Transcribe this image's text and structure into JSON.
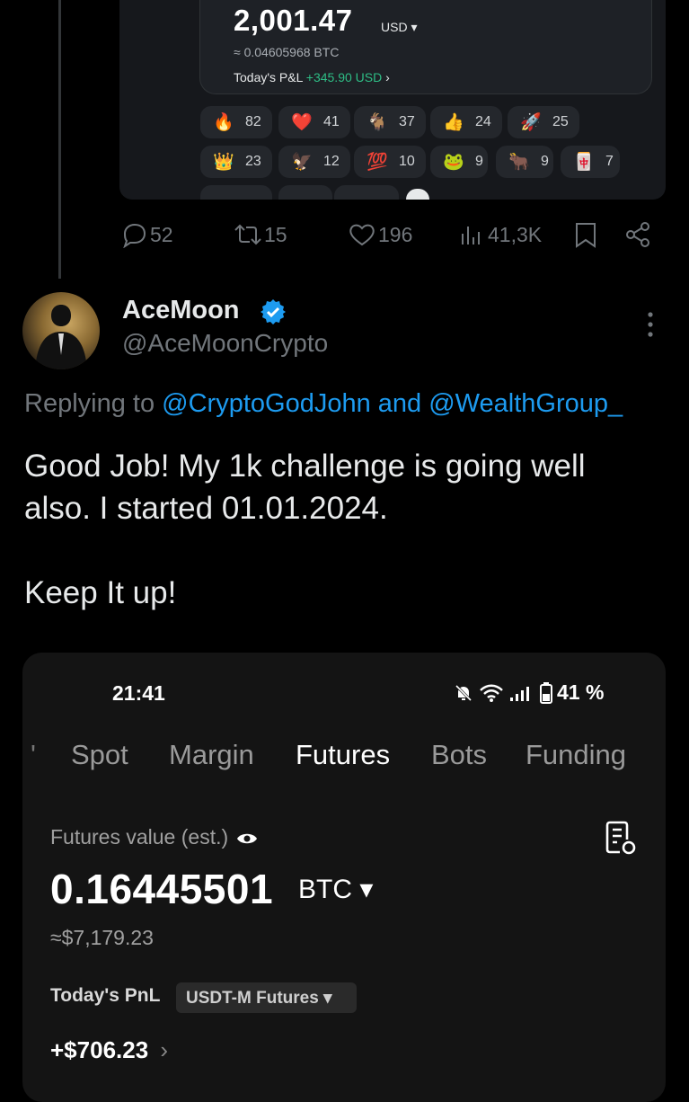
{
  "quoted_card": {
    "amount": "2,001.47",
    "unit": "USD ▾",
    "btc": "≈ 0.04605968 BTC",
    "pnl_label": "Today's P&L",
    "pnl_value": "+345.90 USD",
    "pnl_chevron": "›",
    "reactions": [
      {
        "emoji": "🔥",
        "count": "82"
      },
      {
        "emoji": "❤️",
        "count": "41"
      },
      {
        "emoji": "🐐",
        "count": "37"
      },
      {
        "emoji": "👍",
        "count": "24"
      },
      {
        "emoji": "🚀",
        "count": "25"
      },
      {
        "emoji": "👑",
        "count": "23"
      },
      {
        "emoji": "🦅",
        "count": "12"
      },
      {
        "emoji": "💯",
        "count": "10"
      },
      {
        "emoji": "🐸",
        "count": "9"
      },
      {
        "emoji": "🐂",
        "count": "9"
      },
      {
        "emoji": "🀄",
        "count": "7"
      }
    ]
  },
  "actions": {
    "replies": "52",
    "reposts": "15",
    "likes": "196",
    "views": "41,3K"
  },
  "tweet": {
    "display_name": "AceMoon",
    "handle": "@AceMoonCrypto",
    "replying_prefix": "Replying to ",
    "replying_user1": "@CryptoGodJohn",
    "replying_and": " and ",
    "replying_user2": "@WealthGroup_",
    "body_line1": "Good Job! My 1k challenge is going well",
    "body_line2": "also. I started 01.01.2024.",
    "body_line3": "Keep It up!"
  },
  "screenshot": {
    "time": "21:41",
    "battery": "41 %",
    "tab_partial": "'",
    "tabs": [
      "Spot",
      "Margin",
      "Futures",
      "Bots",
      "Funding"
    ],
    "active_tab": "Futures",
    "futures_label": "Futures value (est.)",
    "futures_value": "0.16445501",
    "futures_unit": "BTC ▾",
    "futures_usd": "≈$7,179.23",
    "pnl_label": "Today's PnL",
    "pnl_filter": "USDT-M Futures ▾",
    "pnl_value": "+$706.23",
    "pnl_chevron": "›"
  },
  "colors": {
    "accent_blue": "#1d9bf0",
    "profit_green": "#2ebd85",
    "muted": "#71767b"
  }
}
